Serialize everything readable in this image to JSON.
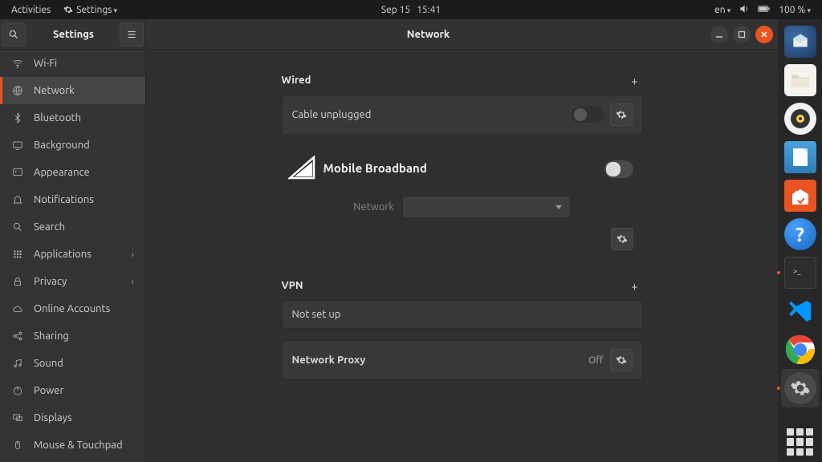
{
  "top": {
    "activities": "Activities",
    "settings": "Settings",
    "date": "Sep 15",
    "time": "15:41",
    "lang": "en",
    "battery": "100 %"
  },
  "window": {
    "app_title": "Settings",
    "page_title": "Network"
  },
  "sidebar": {
    "items": [
      {
        "label": "Wi-Fi"
      },
      {
        "label": "Network"
      },
      {
        "label": "Bluetooth"
      },
      {
        "label": "Background"
      },
      {
        "label": "Appearance"
      },
      {
        "label": "Notifications"
      },
      {
        "label": "Search"
      },
      {
        "label": "Applications",
        "has_sub": true
      },
      {
        "label": "Privacy",
        "has_sub": true
      },
      {
        "label": "Online Accounts"
      },
      {
        "label": "Sharing"
      },
      {
        "label": "Sound"
      },
      {
        "label": "Power"
      },
      {
        "label": "Displays"
      },
      {
        "label": "Mouse & Touchpad"
      }
    ]
  },
  "content": {
    "wired": {
      "heading": "Wired",
      "status": "Cable unplugged"
    },
    "mb": {
      "title": "Mobile Broadband",
      "net_label": "Network"
    },
    "vpn": {
      "heading": "VPN",
      "status": "Not set up"
    },
    "proxy": {
      "label": "Network Proxy",
      "state": "Off"
    }
  }
}
